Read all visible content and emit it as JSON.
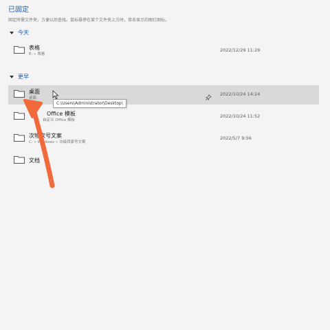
{
  "pinned": {
    "title": "已固定",
    "description": "固定所需文件夹，方便以后查找。鼠标悬停在某个文件夹上方时，单击显示的图钉图标。"
  },
  "sections": {
    "today": "今天",
    "earlier": "更早"
  },
  "today_items": [
    {
      "name": "表格",
      "path": "E: » 表格",
      "date": "2022/12/29 11:29"
    }
  ],
  "earlier_items": [
    {
      "name": "桌面",
      "path": "桌面",
      "date": "2022/10/24 14:24",
      "pinned_icon": "pin-icon",
      "selected": true
    },
    {
      "name": "Office 模板",
      "path": "自定义 Office 模板",
      "date": "2022/10/24 11:52"
    },
    {
      "name": "次物家号文案",
      "path": "C: » Windows » 次级西家号文案",
      "date": "2022/5/7 9:56"
    },
    {
      "name": "文档",
      "path": "",
      "date": ""
    }
  ],
  "tooltip": {
    "text": "C:\\Users\\Administrator\\Desktop\\"
  },
  "colors": {
    "accent": "#1a5fb4",
    "selected_row": "#d9d9d9",
    "annotation_arrow": "#f06a3b"
  }
}
